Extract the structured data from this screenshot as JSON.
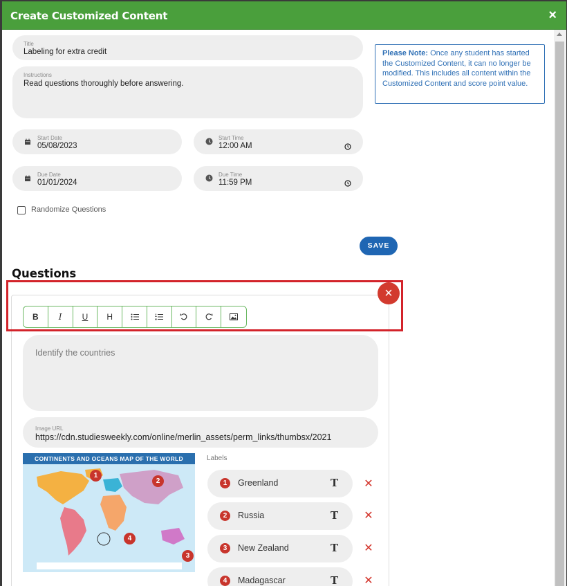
{
  "header": {
    "title": "Create Customized Content",
    "close": "×"
  },
  "form": {
    "title": {
      "label": "Title",
      "value": "Labeling for extra credit"
    },
    "instructions": {
      "label": "Instructions",
      "value": "Read questions thoroughly before answering."
    },
    "start_date": {
      "label": "Start Date",
      "value": "05/08/2023"
    },
    "start_time": {
      "label": "Start Time",
      "value": "12:00 AM"
    },
    "due_date": {
      "label": "Due Date",
      "value": "01/01/2024"
    },
    "due_time": {
      "label": "Due Time",
      "value": "11:59 PM"
    },
    "randomize": {
      "label": "Randomize Questions",
      "checked": false
    },
    "save_label": "SAVE"
  },
  "note": {
    "lead": "Please Note:",
    "text": " Once any student has started the Customized Content, it can no longer be modified. This includes all content within the Customized Content and score point value."
  },
  "questions": {
    "heading": "Questions",
    "delete_icon": "×",
    "toolbar": [
      {
        "name": "bold",
        "glyph": "B"
      },
      {
        "name": "italic",
        "glyph": "I"
      },
      {
        "name": "underline",
        "glyph": "U"
      },
      {
        "name": "heading",
        "glyph": "H"
      },
      {
        "name": "bullet-list",
        "glyph": ""
      },
      {
        "name": "numbered-list",
        "glyph": ""
      },
      {
        "name": "undo",
        "glyph": ""
      },
      {
        "name": "redo",
        "glyph": ""
      },
      {
        "name": "image",
        "glyph": ""
      }
    ],
    "question_text": "Identify the countries",
    "image_url": {
      "label": "Image URL",
      "value": "https://cdn.studiesweekly.com/online/merlin_assets/perm_links/thumbsx/2021"
    },
    "map": {
      "banner": "CONTINENTS AND OCEANS MAP OF THE WORLD",
      "markers": [
        "1",
        "2",
        "3",
        "4"
      ]
    },
    "labels_heading": "Labels",
    "labels": [
      {
        "num": "1",
        "text": "Greenland"
      },
      {
        "num": "2",
        "text": "Russia"
      },
      {
        "num": "3",
        "text": "New Zealand"
      },
      {
        "num": "4",
        "text": "Madagascar"
      }
    ],
    "label_type_icon": "T",
    "label_delete_icon": "✕"
  },
  "colors": {
    "header": "#4a9f3c",
    "accent": "#1f66b3",
    "danger": "#d3232a"
  }
}
